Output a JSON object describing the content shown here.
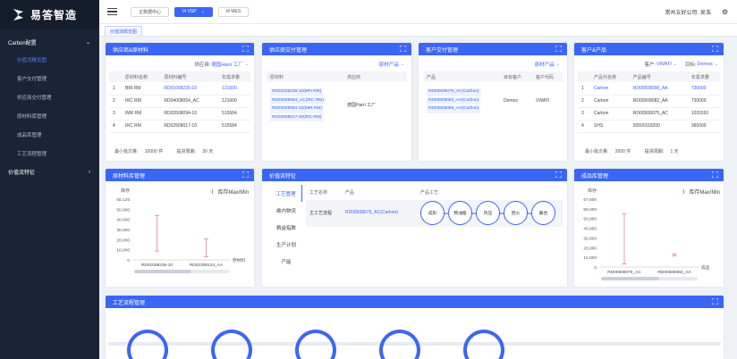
{
  "app": {
    "logo_text": "易答智造"
  },
  "sidebar": {
    "group1": {
      "label": "Carbon配置",
      "arrow": "⌄"
    },
    "items": [
      {
        "label": "价值流概览图",
        "active": true
      },
      {
        "label": "客户交付管理"
      },
      {
        "label": "供应商交付管理"
      },
      {
        "label": "原材料库管理"
      },
      {
        "label": "成品库管理"
      },
      {
        "label": "工艺流程管理"
      }
    ],
    "group2": {
      "label": "价值流特征",
      "arrow": "›"
    }
  },
  "topbar": {
    "btn1": "主数据中心",
    "btn2": "I4 VSP",
    "btn3": "I4 MES",
    "company": "常州五好公司: 吴浩",
    "gear": "⚙"
  },
  "tab": {
    "label": "价值流概览图"
  },
  "supplier_material": {
    "title": "供应商&原材料",
    "filter_label": "供应商:",
    "filter_value": "德国Harri 工厂",
    "headers": [
      "",
      "原材料名称",
      "原材料编号",
      "年需求量"
    ],
    "rows": [
      [
        "1",
        "BRI RM",
        "RD01008235-10",
        "121600"
      ],
      [
        "2",
        "IRC RM",
        "RD04008054_AC",
        "121600"
      ],
      [
        "3",
        "IMR RM",
        "RD03508094-10",
        "515584"
      ],
      [
        "4",
        "IRC RM",
        "RD02508017-10",
        "515584"
      ]
    ],
    "min_batch_label": "最小批次量:",
    "min_batch_value": "10000 件",
    "cycle_label": "提货周期:",
    "cycle_value": "30 天"
  },
  "supplier_delivery": {
    "title": "供应商交付管理",
    "filter_value": "原材产品",
    "headers": [
      "原材料",
      "供应商"
    ],
    "materials": [
      "RD01008235-10(BRI RM)",
      "RD04008054_AC(IRC RM)",
      "RD03508094-10(IMR RM)",
      "RD02508017-10(IRC RM)"
    ],
    "supplier": "德国Harri 工厂"
  },
  "customer_delivery": {
    "title": "客户交付管理",
    "filter_value": "原材产品",
    "headers": [
      "产品",
      "目标客户",
      "客户代码"
    ],
    "products": [
      "RD00508075_AC(Carbon)",
      "RD00508082_AA(Carbon)",
      "RD00508098_AA(Carbon)"
    ],
    "customer": "Demos",
    "code": "VWATI"
  },
  "customer_product": {
    "title": "客户&产品",
    "filter1_label": "客户:",
    "filter1_value": "VWATI",
    "filter2_label": "目标:",
    "filter2_value": "Demos",
    "headers": [
      "",
      "产品代名称",
      "产品编号",
      "年需求量"
    ],
    "rows": [
      [
        "1",
        "Carbon",
        "RD00508098_AA",
        "730000"
      ],
      [
        "2",
        "Carbon",
        "RD00508082_AA",
        "730000"
      ],
      [
        "3",
        "Carbon",
        "RD00508075_AC",
        "1031591"
      ],
      [
        "4",
        "SHS",
        "50500118200",
        "365000"
      ]
    ],
    "min_batch_label": "最小批次量:",
    "min_batch_value": "2000 件",
    "cycle_label": "提货周期:",
    "cycle_value": "1 天"
  },
  "raw_stock": {
    "title": "原材料库管理",
    "legend": "库存Max/Min",
    "ylabel": "库存",
    "xlabel": "原材料"
  },
  "value_flow": {
    "title": "价值流特征",
    "vtabs": [
      "工艺管理",
      "维内物流",
      "精益指数",
      "生产计划",
      "产能"
    ],
    "headers": [
      "工艺名称",
      "产品",
      "产品工艺"
    ],
    "row_name": "主工艺流程",
    "row_product": "RD00508075_AC(Carbon)",
    "steps": [
      "成形",
      "预油脂",
      "热压",
      "回火",
      "最合"
    ]
  },
  "finished_stock": {
    "title": "成品库管理",
    "legend": "库存Max/Min",
    "ylabel": "库存",
    "xlabel": "成品"
  },
  "process_flow": {
    "title": "工艺流程管理"
  },
  "chart_data": [
    {
      "type": "bar",
      "title": "原材料库管理",
      "ylabel": "库存",
      "xlabel": "原材料",
      "categories": [
        "RD01008235-10",
        "RD02308124_AA"
      ],
      "y_ticks": [
        "55,125",
        "50,000",
        "40,000",
        "30,000",
        "20,000",
        "10,000",
        "0"
      ],
      "ylim": [
        0,
        55125
      ],
      "series": [
        {
          "name": "库存Max/Min",
          "ranges": [
            [
              8000,
              40000
            ],
            [
              3000,
              19000
            ]
          ]
        }
      ]
    },
    {
      "type": "bar",
      "title": "成品库管理",
      "ylabel": "库存",
      "xlabel": "成品",
      "categories": [
        "RD00508075_AC",
        "RD00508082_AA"
      ],
      "y_ticks": [
        "67,500",
        "60,000",
        "50,000",
        "40,000",
        "30,000",
        "20,000",
        "10,000",
        "0"
      ],
      "ylim": [
        0,
        67500
      ],
      "series": [
        {
          "name": "库存Max/Min",
          "ranges": [
            [
              3000,
              53000
            ],
            [
              11000,
              13000
            ]
          ]
        }
      ]
    }
  ]
}
